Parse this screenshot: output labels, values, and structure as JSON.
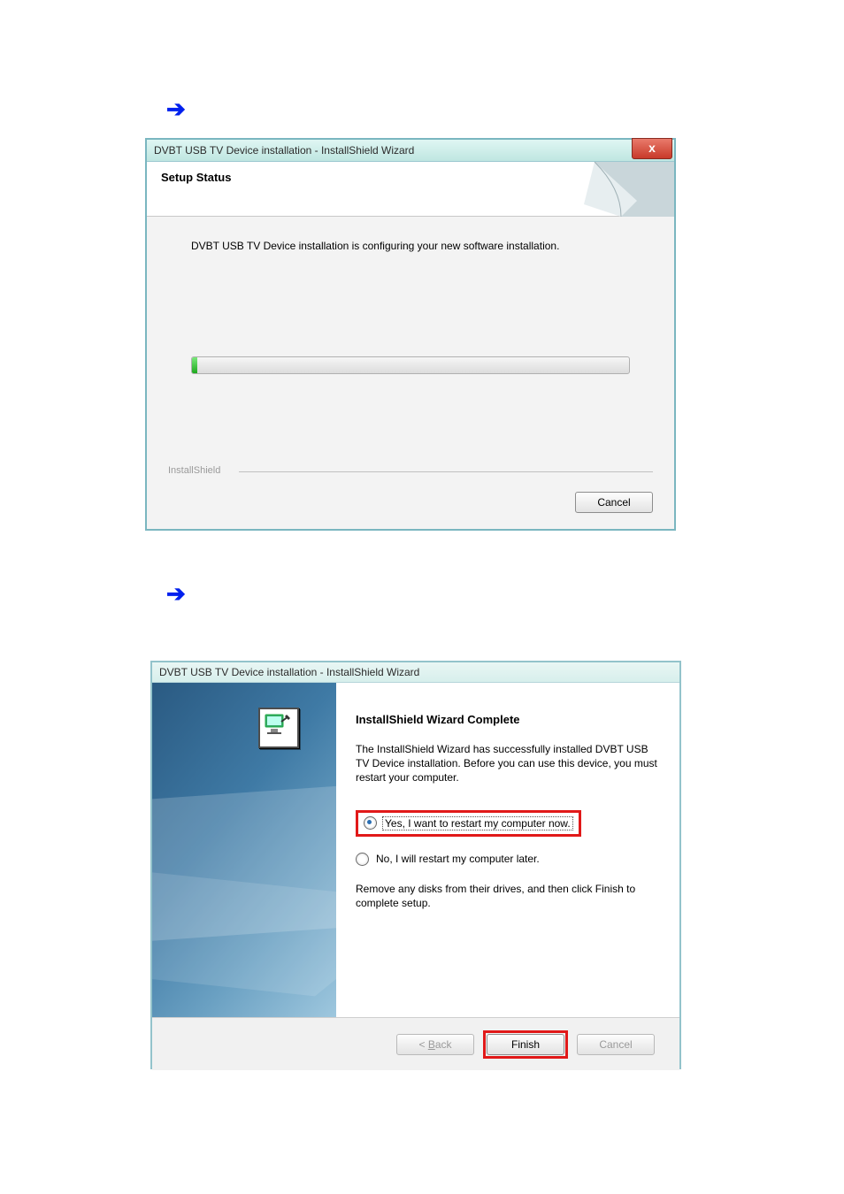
{
  "arrow_glyph": "➔",
  "dialog1": {
    "title": "DVBT USB TV Device installation - InstallShield Wizard",
    "close_glyph": "x",
    "header_title": "Setup Status",
    "body_message": "DVBT USB TV Device installation is configuring your new software installation.",
    "brand_label": "InstallShield",
    "cancel_label": "Cancel"
  },
  "dialog2": {
    "title": "DVBT USB TV Device installation - InstallShield Wizard",
    "heading": "InstallShield Wizard Complete",
    "paragraph": "The InstallShield Wizard has successfully installed DVBT USB TV Device installation.  Before you can use this device, you must restart your computer.",
    "option_yes": "Yes, I want to restart my computer now.",
    "option_no": "No, I will restart my computer later.",
    "footer_note": "Remove any disks from their drives, and then click Finish to complete setup.",
    "back_prefix": "< ",
    "back_u": "B",
    "back_rest": "ack",
    "finish_label": "Finish",
    "cancel_label": "Cancel"
  }
}
